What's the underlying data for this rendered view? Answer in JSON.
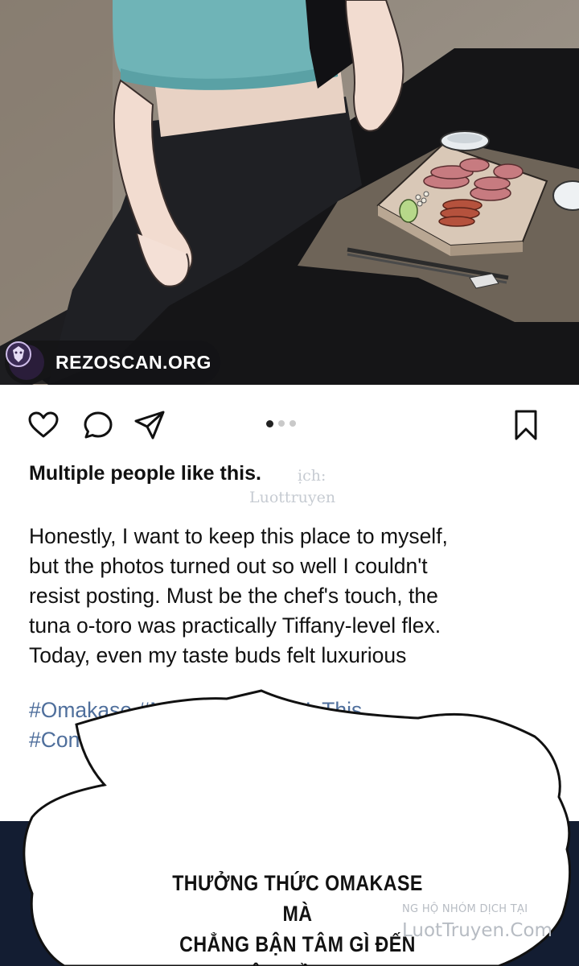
{
  "banner": {
    "site": "REZOSCAN.ORG",
    "logo_icon": "lion-head-icon"
  },
  "post": {
    "icons": {
      "like": "heart-icon",
      "comment": "comment-bubble-icon",
      "share": "send-paper-plane-icon",
      "save": "bookmark-icon"
    },
    "carousel": {
      "count": 3,
      "active": 1
    },
    "likes_text": "Multiple people like this.",
    "caption_lines": [
      "Honestly, I want to keep this place to myself,",
      "but the photos turned out so well I couldn't",
      "resist posting. Must be the chef's touch, the",
      "tuna o-toro was practically Tiffany-level flex.",
      "Today, even my taste buds felt luxurious"
    ],
    "hashtag_lines": [
      "#Omakase #Mo",
      "reIsThis",
      "#Con"
    ]
  },
  "watermark": {
    "line1": "ịch:",
    "line2": "Luottruyen"
  },
  "speech": {
    "lines": [
      "THƯỞNG THỨC OMAKASE MÀ",
      "CHẲNG BẬN TÂM GÌ ĐẾN",
      "CHUYỆN TIỀN NONG?"
    ]
  },
  "credit": {
    "line1": "NG HỘ NHÓM DỊCH TẠI",
    "line2": "LuotTruyen.Com"
  },
  "colors": {
    "hashtag": "#4f6f9c",
    "text": "#111111",
    "panel_table": "#141416",
    "wall": "#938a7f"
  }
}
